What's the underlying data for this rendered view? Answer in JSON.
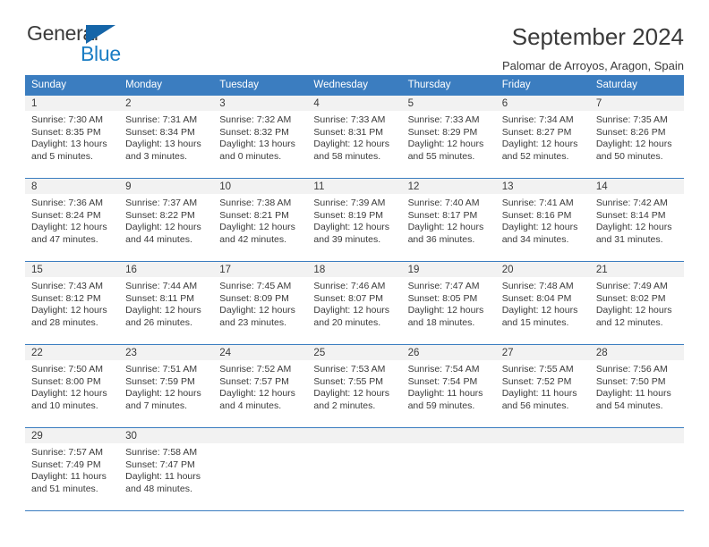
{
  "logo": {
    "word_top": "General",
    "word_bottom": "Blue",
    "triangle_color": "#1565a8",
    "blue": "#1a7dc4"
  },
  "header": {
    "title": "September 2024",
    "subtitle": "Palomar de Arroyos, Aragon, Spain"
  },
  "theme": {
    "header_bg": "#3b7dc0",
    "header_text": "#ffffff",
    "daynum_bg": "#f2f2f2",
    "cell_text": "#3a3a3a"
  },
  "weekdays": [
    "Sunday",
    "Monday",
    "Tuesday",
    "Wednesday",
    "Thursday",
    "Friday",
    "Saturday"
  ],
  "labels": {
    "sunrise_prefix": "Sunrise:",
    "sunset_prefix": "Sunset:",
    "daylight_prefix": "Daylight:"
  },
  "weeks": [
    [
      {
        "day": "1",
        "sunrise": "Sunrise: 7:30 AM",
        "sunset": "Sunset: 8:35 PM",
        "daylight_line1": "Daylight: 13 hours",
        "daylight_line2": "and 5 minutes."
      },
      {
        "day": "2",
        "sunrise": "Sunrise: 7:31 AM",
        "sunset": "Sunset: 8:34 PM",
        "daylight_line1": "Daylight: 13 hours",
        "daylight_line2": "and 3 minutes."
      },
      {
        "day": "3",
        "sunrise": "Sunrise: 7:32 AM",
        "sunset": "Sunset: 8:32 PM",
        "daylight_line1": "Daylight: 13 hours",
        "daylight_line2": "and 0 minutes."
      },
      {
        "day": "4",
        "sunrise": "Sunrise: 7:33 AM",
        "sunset": "Sunset: 8:31 PM",
        "daylight_line1": "Daylight: 12 hours",
        "daylight_line2": "and 58 minutes."
      },
      {
        "day": "5",
        "sunrise": "Sunrise: 7:33 AM",
        "sunset": "Sunset: 8:29 PM",
        "daylight_line1": "Daylight: 12 hours",
        "daylight_line2": "and 55 minutes."
      },
      {
        "day": "6",
        "sunrise": "Sunrise: 7:34 AM",
        "sunset": "Sunset: 8:27 PM",
        "daylight_line1": "Daylight: 12 hours",
        "daylight_line2": "and 52 minutes."
      },
      {
        "day": "7",
        "sunrise": "Sunrise: 7:35 AM",
        "sunset": "Sunset: 8:26 PM",
        "daylight_line1": "Daylight: 12 hours",
        "daylight_line2": "and 50 minutes."
      }
    ],
    [
      {
        "day": "8",
        "sunrise": "Sunrise: 7:36 AM",
        "sunset": "Sunset: 8:24 PM",
        "daylight_line1": "Daylight: 12 hours",
        "daylight_line2": "and 47 minutes."
      },
      {
        "day": "9",
        "sunrise": "Sunrise: 7:37 AM",
        "sunset": "Sunset: 8:22 PM",
        "daylight_line1": "Daylight: 12 hours",
        "daylight_line2": "and 44 minutes."
      },
      {
        "day": "10",
        "sunrise": "Sunrise: 7:38 AM",
        "sunset": "Sunset: 8:21 PM",
        "daylight_line1": "Daylight: 12 hours",
        "daylight_line2": "and 42 minutes."
      },
      {
        "day": "11",
        "sunrise": "Sunrise: 7:39 AM",
        "sunset": "Sunset: 8:19 PM",
        "daylight_line1": "Daylight: 12 hours",
        "daylight_line2": "and 39 minutes."
      },
      {
        "day": "12",
        "sunrise": "Sunrise: 7:40 AM",
        "sunset": "Sunset: 8:17 PM",
        "daylight_line1": "Daylight: 12 hours",
        "daylight_line2": "and 36 minutes."
      },
      {
        "day": "13",
        "sunrise": "Sunrise: 7:41 AM",
        "sunset": "Sunset: 8:16 PM",
        "daylight_line1": "Daylight: 12 hours",
        "daylight_line2": "and 34 minutes."
      },
      {
        "day": "14",
        "sunrise": "Sunrise: 7:42 AM",
        "sunset": "Sunset: 8:14 PM",
        "daylight_line1": "Daylight: 12 hours",
        "daylight_line2": "and 31 minutes."
      }
    ],
    [
      {
        "day": "15",
        "sunrise": "Sunrise: 7:43 AM",
        "sunset": "Sunset: 8:12 PM",
        "daylight_line1": "Daylight: 12 hours",
        "daylight_line2": "and 28 minutes."
      },
      {
        "day": "16",
        "sunrise": "Sunrise: 7:44 AM",
        "sunset": "Sunset: 8:11 PM",
        "daylight_line1": "Daylight: 12 hours",
        "daylight_line2": "and 26 minutes."
      },
      {
        "day": "17",
        "sunrise": "Sunrise: 7:45 AM",
        "sunset": "Sunset: 8:09 PM",
        "daylight_line1": "Daylight: 12 hours",
        "daylight_line2": "and 23 minutes."
      },
      {
        "day": "18",
        "sunrise": "Sunrise: 7:46 AM",
        "sunset": "Sunset: 8:07 PM",
        "daylight_line1": "Daylight: 12 hours",
        "daylight_line2": "and 20 minutes."
      },
      {
        "day": "19",
        "sunrise": "Sunrise: 7:47 AM",
        "sunset": "Sunset: 8:05 PM",
        "daylight_line1": "Daylight: 12 hours",
        "daylight_line2": "and 18 minutes."
      },
      {
        "day": "20",
        "sunrise": "Sunrise: 7:48 AM",
        "sunset": "Sunset: 8:04 PM",
        "daylight_line1": "Daylight: 12 hours",
        "daylight_line2": "and 15 minutes."
      },
      {
        "day": "21",
        "sunrise": "Sunrise: 7:49 AM",
        "sunset": "Sunset: 8:02 PM",
        "daylight_line1": "Daylight: 12 hours",
        "daylight_line2": "and 12 minutes."
      }
    ],
    [
      {
        "day": "22",
        "sunrise": "Sunrise: 7:50 AM",
        "sunset": "Sunset: 8:00 PM",
        "daylight_line1": "Daylight: 12 hours",
        "daylight_line2": "and 10 minutes."
      },
      {
        "day": "23",
        "sunrise": "Sunrise: 7:51 AM",
        "sunset": "Sunset: 7:59 PM",
        "daylight_line1": "Daylight: 12 hours",
        "daylight_line2": "and 7 minutes."
      },
      {
        "day": "24",
        "sunrise": "Sunrise: 7:52 AM",
        "sunset": "Sunset: 7:57 PM",
        "daylight_line1": "Daylight: 12 hours",
        "daylight_line2": "and 4 minutes."
      },
      {
        "day": "25",
        "sunrise": "Sunrise: 7:53 AM",
        "sunset": "Sunset: 7:55 PM",
        "daylight_line1": "Daylight: 12 hours",
        "daylight_line2": "and 2 minutes."
      },
      {
        "day": "26",
        "sunrise": "Sunrise: 7:54 AM",
        "sunset": "Sunset: 7:54 PM",
        "daylight_line1": "Daylight: 11 hours",
        "daylight_line2": "and 59 minutes."
      },
      {
        "day": "27",
        "sunrise": "Sunrise: 7:55 AM",
        "sunset": "Sunset: 7:52 PM",
        "daylight_line1": "Daylight: 11 hours",
        "daylight_line2": "and 56 minutes."
      },
      {
        "day": "28",
        "sunrise": "Sunrise: 7:56 AM",
        "sunset": "Sunset: 7:50 PM",
        "daylight_line1": "Daylight: 11 hours",
        "daylight_line2": "and 54 minutes."
      }
    ],
    [
      {
        "day": "29",
        "sunrise": "Sunrise: 7:57 AM",
        "sunset": "Sunset: 7:49 PM",
        "daylight_line1": "Daylight: 11 hours",
        "daylight_line2": "and 51 minutes."
      },
      {
        "day": "30",
        "sunrise": "Sunrise: 7:58 AM",
        "sunset": "Sunset: 7:47 PM",
        "daylight_line1": "Daylight: 11 hours",
        "daylight_line2": "and 48 minutes."
      },
      null,
      null,
      null,
      null,
      null
    ]
  ]
}
